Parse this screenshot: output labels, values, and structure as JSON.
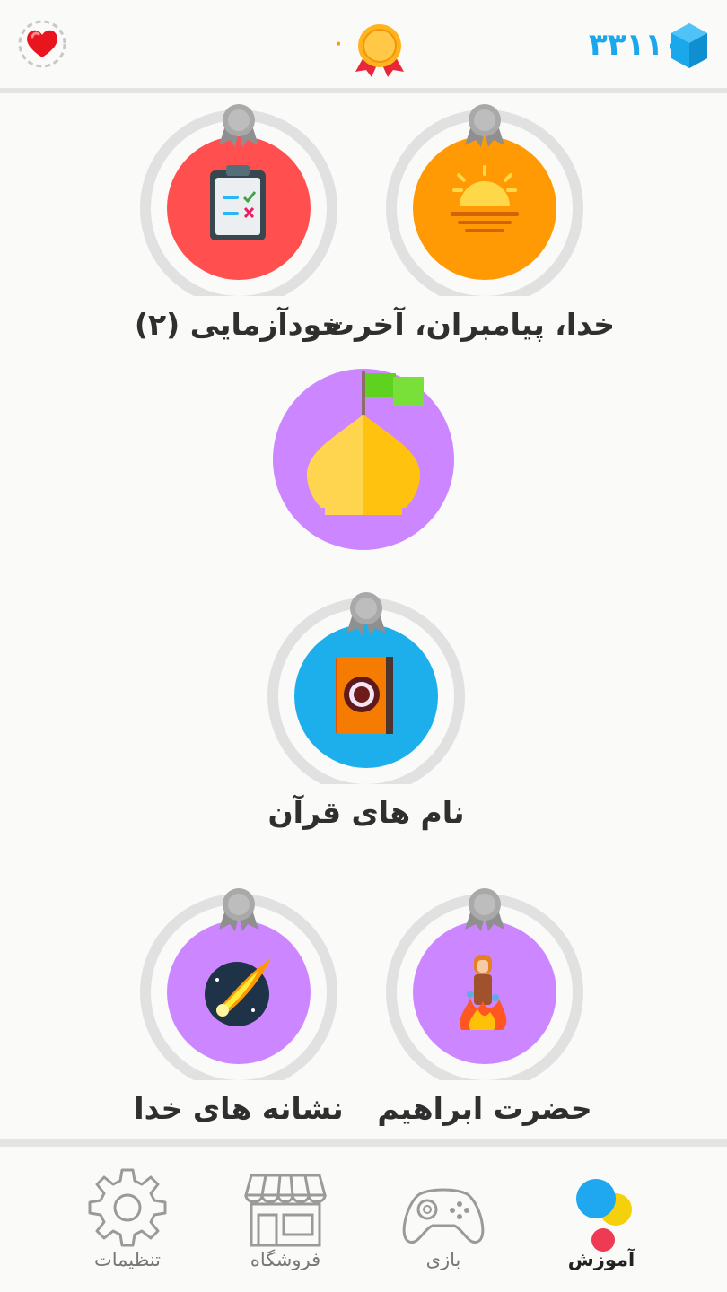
{
  "header": {
    "medal_count": "۰",
    "gems_count": "۳۳۱۱۰"
  },
  "skills": [
    {
      "label": "خدا، پیامبران، آخرت",
      "icon": "sunset-icon",
      "color": "#ff9a05"
    },
    {
      "label": "خودآزمایی (۲)",
      "icon": "clipboard-checklist-icon",
      "color": "#ff4f4f"
    },
    {
      "label": "",
      "icon": "golden-dome-flag-icon",
      "color": "#cc86ff"
    },
    {
      "label": "نام های قرآن",
      "icon": "quran-book-icon",
      "color": "#1cafec"
    },
    {
      "label": "حضرت ابراهیم",
      "icon": "fire-figure-icon",
      "color": "#cc86ff"
    },
    {
      "label": "نشانه های خدا",
      "icon": "comet-icon",
      "color": "#cc86ff"
    }
  ],
  "bottom_nav": {
    "learn_label": "آموزش",
    "game_label": "بازی",
    "shop_label": "فروشگاه",
    "settings_label": "تنظیمات"
  },
  "colors": {
    "gems_blue": "#1aa7ec",
    "medal_orange": "#f59a0c",
    "ring_gray": "#e1e1e1",
    "badge_gray": "#a9a9a9"
  }
}
